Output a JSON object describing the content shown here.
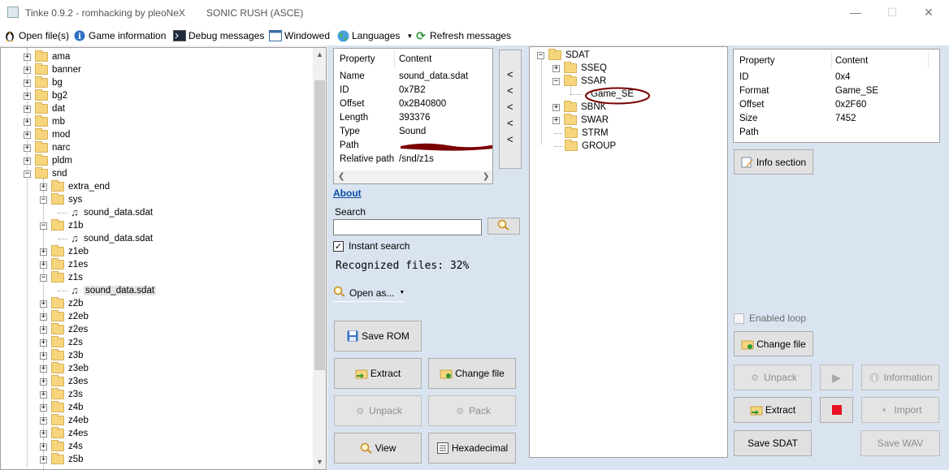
{
  "window": {
    "title": "Tinke 0.9.2 - romhacking by pleoNeX",
    "game_title": "SONIC RUSH (ASCE)",
    "minimize": "—",
    "maximize": "☐",
    "close": "✕"
  },
  "toolbar": {
    "open_files": "Open file(s)",
    "game_information": "Game information",
    "debug_messages": "Debug messages",
    "windowed": "Windowed",
    "languages": "Languages",
    "refresh_messages": "Refresh messages"
  },
  "file_tree": {
    "items": [
      {
        "label": "ama"
      },
      {
        "label": "banner"
      },
      {
        "label": "bg"
      },
      {
        "label": "bg2"
      },
      {
        "label": "dat"
      },
      {
        "label": "mb"
      },
      {
        "label": "mod"
      },
      {
        "label": "narc"
      },
      {
        "label": "pldm"
      },
      {
        "label": "snd"
      },
      {
        "label": "extra_end"
      },
      {
        "label": "sys"
      },
      {
        "label": "sound_data.sdat"
      },
      {
        "label": "z1b"
      },
      {
        "label": "sound_data.sdat"
      },
      {
        "label": "z1eb"
      },
      {
        "label": "z1es"
      },
      {
        "label": "z1s"
      },
      {
        "label": "sound_data.sdat"
      },
      {
        "label": "z2b"
      },
      {
        "label": "z2eb"
      },
      {
        "label": "z2es"
      },
      {
        "label": "z2s"
      },
      {
        "label": "z3b"
      },
      {
        "label": "z3eb"
      },
      {
        "label": "z3es"
      },
      {
        "label": "z3s"
      },
      {
        "label": "z4b"
      },
      {
        "label": "z4eb"
      },
      {
        "label": "z4es"
      },
      {
        "label": "z4s"
      },
      {
        "label": "z5b"
      }
    ]
  },
  "file_props": {
    "header_property": "Property",
    "header_content": "Content",
    "rows": [
      {
        "k": "Name",
        "v": "sound_data.sdat"
      },
      {
        "k": "ID",
        "v": "0x7B2"
      },
      {
        "k": "Offset",
        "v": "0x2B40800"
      },
      {
        "k": "Length",
        "v": "393376"
      },
      {
        "k": "Type",
        "v": "Sound"
      },
      {
        "k": "Path",
        "v": ""
      },
      {
        "k": "Relative path",
        "v": "/snd/z1s"
      }
    ],
    "back_arrows": [
      "<",
      "<",
      "<",
      "<",
      "<"
    ]
  },
  "middle": {
    "about": "About",
    "search_label": "Search",
    "search_value": "",
    "instant_search": "Instant search",
    "recognized": "Recognized files: 32%",
    "open_as": "Open as...",
    "save_rom": "Save ROM",
    "extract": "Extract",
    "change_file": "Change file",
    "unpack": "Unpack",
    "pack": "Pack",
    "view": "View",
    "hexadecimal": "Hexadecimal"
  },
  "sdat_tree": {
    "root": "SDAT",
    "items": [
      "SSEQ",
      "SSAR",
      "Game_SE",
      "SBNK",
      "SWAR",
      "STRM",
      "GROUP"
    ]
  },
  "sdat_props": {
    "header_property": "Property",
    "header_content": "Content",
    "rows": [
      {
        "k": "ID",
        "v": "0x4"
      },
      {
        "k": "Format",
        "v": "Game_SE"
      },
      {
        "k": "Offset",
        "v": "0x2F60"
      },
      {
        "k": "Size",
        "v": "7452"
      },
      {
        "k": "Path",
        "v": ""
      }
    ]
  },
  "right": {
    "info_section": "Info section",
    "enabled_loop": "Enabled loop",
    "change_file": "Change file",
    "unpack": "Unpack",
    "information": "Information",
    "extract": "Extract",
    "import": "Import",
    "save_sdat": "Save SDAT",
    "save_wav": "Save WAV"
  },
  "colors": {
    "panel_blue": "#d9e4f0",
    "stop_red": "#e81123",
    "annotation": "#7a0000"
  }
}
